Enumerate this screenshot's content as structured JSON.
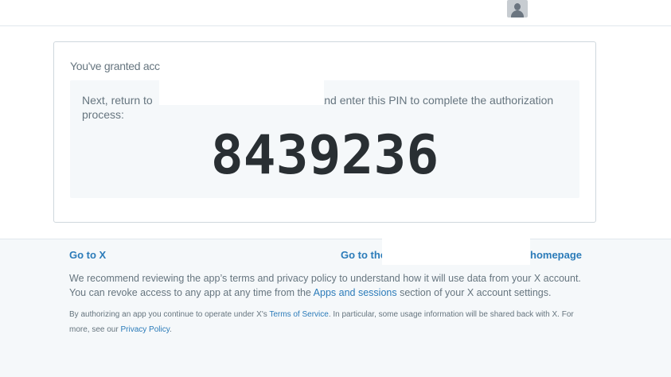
{
  "card": {
    "granted_text": "You've granted acc",
    "instruction_before": "Next, return to",
    "instruction_after": "and enter this PIN to complete the authorization process:",
    "pin": "8439236"
  },
  "footer": {
    "go_to_x": "Go to X",
    "go_to_the": "Go to the",
    "homepage": "homepage",
    "recommend_1": "We recommend reviewing the app’s terms and privacy policy to understand how it will use data from your X account.",
    "recommend_2a": "You can revoke access to any app at any time from the ",
    "apps_sessions": "Apps and sessions",
    "recommend_2b": " section of your X account settings.",
    "small_1": "By authorizing an app you continue to operate under X's ",
    "terms": "Terms of Service",
    "small_2": ". In particular, some usage information will be shared back with X. For more, see our ",
    "privacy": "Privacy Policy",
    "small_3": "."
  },
  "colors": {
    "link": "#2b7bb9",
    "muted_text": "#66757f",
    "pin_text": "#292f33",
    "footer_bg": "#f5f8fa"
  },
  "icons": {
    "avatar": "user-avatar-icon"
  }
}
